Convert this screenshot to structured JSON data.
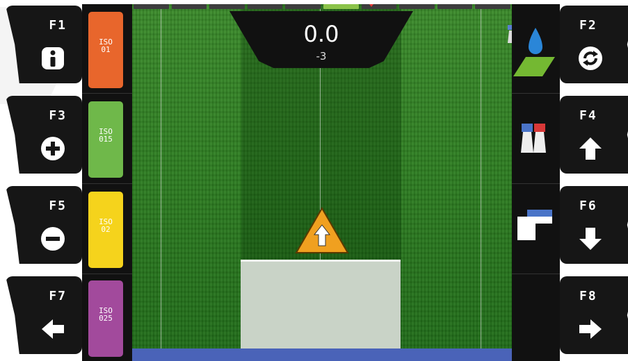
{
  "fkeys": {
    "f1": {
      "label": "F1",
      "icon": "info-icon"
    },
    "f2": {
      "label": "F2",
      "icon": "refresh-icon"
    },
    "f3": {
      "label": "F3",
      "icon": "plus-icon"
    },
    "f4": {
      "label": "F4",
      "icon": "arrow-up-icon"
    },
    "f5": {
      "label": "F5",
      "icon": "minus-icon"
    },
    "f6": {
      "label": "F6",
      "icon": "arrow-down-icon"
    },
    "f7": {
      "label": "F7",
      "icon": "arrow-left-icon"
    },
    "f8": {
      "label": "F8",
      "icon": "arrow-right-icon"
    }
  },
  "iso_buttons": [
    {
      "line1": "ISO",
      "line2": "01",
      "color": "#e8662c"
    },
    {
      "line1": "ISO",
      "line2": "015",
      "color": "#6fb84a"
    },
    {
      "line1": "ISO",
      "line2": "02",
      "color": "#f5d31c"
    },
    {
      "line1": "ISO",
      "line2": "025",
      "color": "#a24a9c"
    }
  ],
  "speed": {
    "value": "0.0",
    "offset": "-3"
  },
  "boom_segments": {
    "count": 10,
    "active_index": 5
  },
  "colors": {
    "accent": "#f0a020",
    "field": "#2f7f22",
    "implement": "#c9d3c7",
    "bottom_bar": "#4a63b8"
  },
  "right_icons": [
    "water-field-icon",
    "nozzle-pair-icon",
    "boom-fold-icon"
  ]
}
